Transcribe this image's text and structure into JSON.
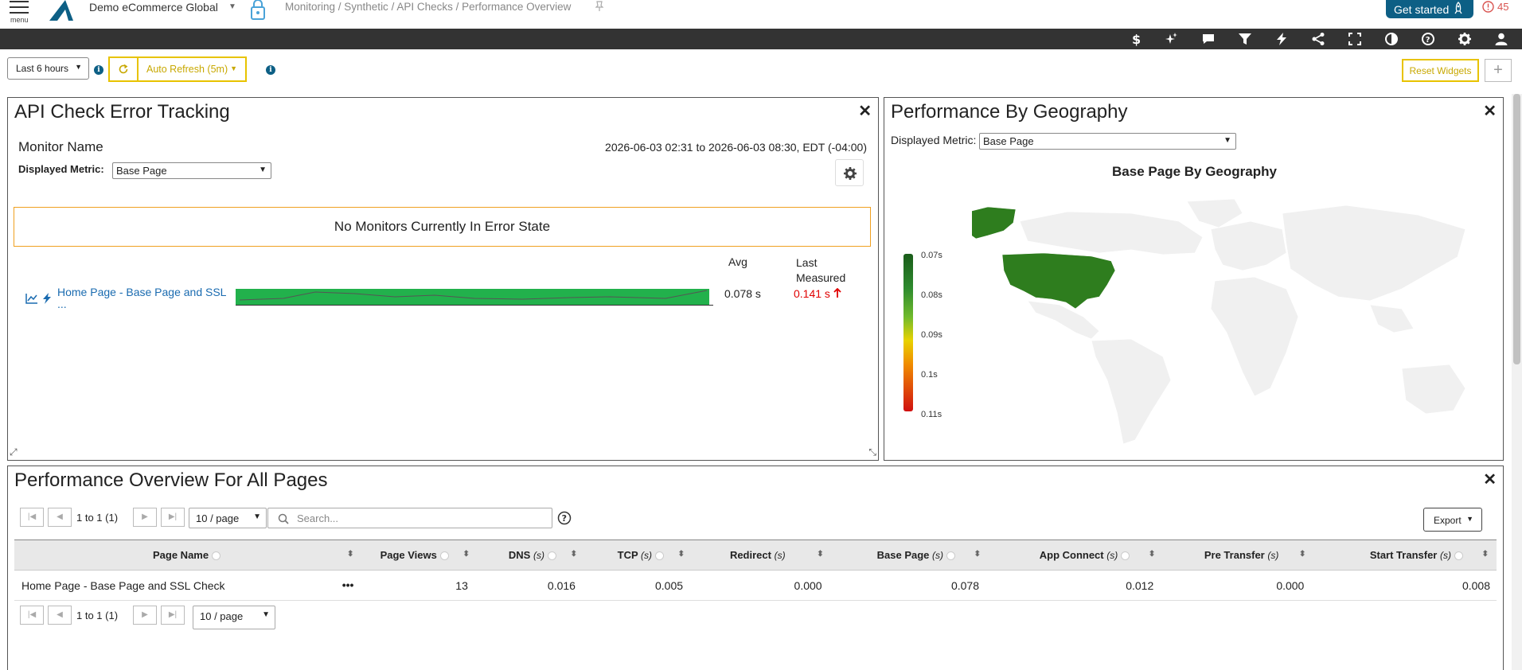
{
  "header": {
    "menu_label": "menu",
    "org_name": "Demo eCommerce Global",
    "breadcrumb": "Monitoring / Synthetic / API Checks / Performance Overview",
    "get_started": "Get started",
    "alert_count": "45"
  },
  "toolbar": {
    "icons": [
      "dollar-icon",
      "sparkle-icon",
      "comment-icon",
      "filter-icon",
      "bolt-icon",
      "share-icon",
      "fullscreen-icon",
      "contrast-icon",
      "help-icon",
      "gear-icon",
      "user-icon"
    ]
  },
  "controls": {
    "time_range": "Last 6 hours",
    "auto_refresh": "Auto Refresh (5m)",
    "reset_widgets": "Reset Widgets",
    "add_widget": "+"
  },
  "error_panel": {
    "title": "API Check Error Tracking",
    "monitor_name": "Monitor Name",
    "date_range": "2026-06-03 02:31 to 2026-06-03 08:30, EDT (-04:00)",
    "metric_label": "Displayed Metric:",
    "metric_value": "Base Page",
    "no_monitors": "No Monitors Currently In Error State",
    "col_avg": "Avg",
    "col_last": "Last Measured",
    "monitor": {
      "name_line1": "Home Page - Base Page and SSL",
      "name_line2": "...",
      "avg": "0.078 s",
      "last": "0.141 s"
    }
  },
  "geo_panel": {
    "title": "Performance By Geography",
    "metric_label": "Displayed Metric:",
    "metric_value": "Base Page",
    "chart_title": "Base Page By Geography",
    "legend": [
      "0.07s",
      "0.08s",
      "0.09s",
      "0.1s",
      "0.11s"
    ],
    "colors": {
      "highlight": "#2e7d1e",
      "land": "#f0f0f0"
    }
  },
  "perf_panel": {
    "title": "Performance Overview For All Pages",
    "pager_text": "1 to 1 (1)",
    "per_page": "10 / page",
    "search_placeholder": "Search...",
    "export": "Export",
    "columns": {
      "page_name": "Page Name",
      "page_views": "Page Views",
      "dns": "DNS",
      "tcp": "TCP",
      "redirect": "Redirect",
      "base_page": "Base Page",
      "app_connect": "App Connect",
      "pre_transfer": "Pre Transfer",
      "start_transfer": "Start Transfer",
      "unit": "(s)"
    },
    "row": {
      "page_name": "Home Page - Base Page and SSL Check",
      "page_views": "13",
      "dns": "0.016",
      "tcp": "0.005",
      "redirect": "0.000",
      "base_page": "0.078",
      "app_connect": "0.012",
      "pre_transfer": "0.000",
      "start_transfer": "0.008"
    }
  }
}
